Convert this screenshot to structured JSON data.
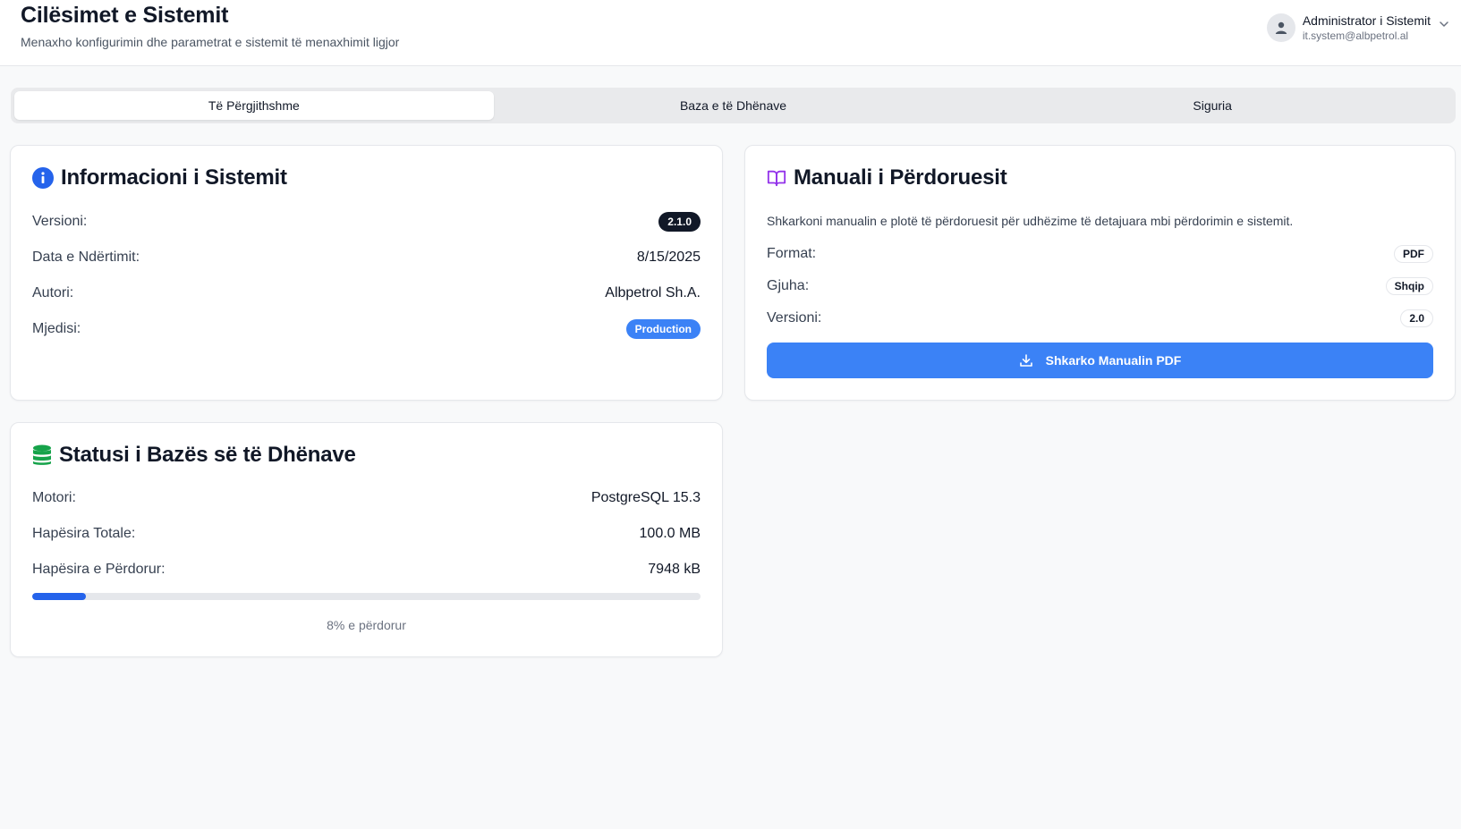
{
  "header": {
    "title": "Cilësimet e Sistemit",
    "subtitle": "Menaxho konfigurimin dhe parametrat e sistemit të menaxhimit ligjor",
    "user": {
      "name": "Administrator i Sistemit",
      "email": "it.system@albpetrol.al",
      "avatar_icon": "user-icon",
      "menu_icon": "chevron-down-icon"
    }
  },
  "tabs": [
    {
      "label": "Të Përgjithshme",
      "active": true
    },
    {
      "label": "Baza e të Dhënave",
      "active": false
    },
    {
      "label": "Siguria",
      "active": false
    }
  ],
  "system_info": {
    "title": "Informacioni i Sistemit",
    "icon": "info-icon",
    "version_label": "Versioni:",
    "version_value": "2.1.0",
    "build_date_label": "Data e Ndërtimit:",
    "build_date_value": "8/15/2025",
    "author_label": "Autori:",
    "author_value": "Albpetrol Sh.A.",
    "environment_label": "Mjedisi:",
    "environment_value": "Production"
  },
  "user_manual": {
    "title": "Manuali i Përdoruesit",
    "icon": "book-open-icon",
    "description": "Shkarkoni manualin e plotë të përdoruesit për udhëzime të detajuara mbi përdorimin e sistemit.",
    "format_label": "Format:",
    "format_value": "PDF",
    "language_label": "Gjuha:",
    "language_value": "Shqip",
    "version_label": "Versioni:",
    "version_value": "2.0",
    "download_button": "Shkarko Manualin PDF",
    "download_icon": "download-icon"
  },
  "database_status": {
    "title": "Statusi i Bazës së të Dhënave",
    "icon": "database-icon",
    "engine_label": "Motori:",
    "engine_value": "PostgreSQL 15.3",
    "total_space_label": "Hapësira Totale:",
    "total_space_value": "100.0 MB",
    "used_space_label": "Hapësira e Përdorur:",
    "used_space_value": "7948 kB",
    "usage_percent": 8,
    "usage_text": "8% e përdorur"
  },
  "colors": {
    "accent": "#3b82f6",
    "info_icon": "#2563eb",
    "book_icon": "#9333ea",
    "database_icon": "#16a34a",
    "progress": "#2563eb"
  }
}
